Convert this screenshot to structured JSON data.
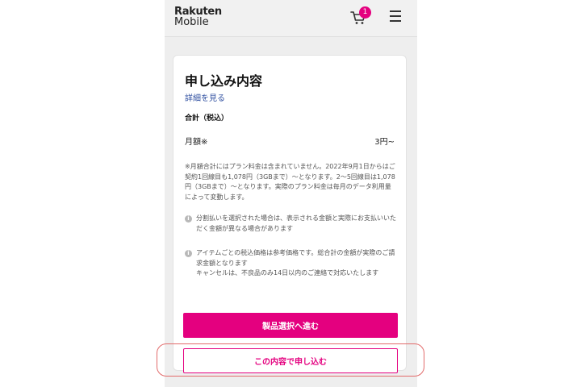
{
  "header": {
    "logo_line1": "Rakuten",
    "logo_line2": "Mobile",
    "cart_icon": "cart-icon",
    "cart_badge": "1",
    "menu_icon": "hamburger-menu-icon"
  },
  "order": {
    "title": "申し込み内容",
    "detail_link": "詳細を見る",
    "total_label": "合計（税込）",
    "monthly_label": "月額※",
    "monthly_value": "3円~",
    "note": "※月額合計にはプラン料金は含まれていません。2022年9月1日からはご契約1回線目も1,078円（3GBまで）〜となります。2〜5回線目は1,078円（3GBまで）〜となります。実際のプラン料金は毎月のデータ利用量によって変動します。",
    "info1": "分割払いを選択された場合は、表示される金額と実際にお支払いいただく金額が異なる場合があります",
    "info2_line1": "アイテムごとの税込価格は参考価格です。総合計の金額が実際のご請求金額となります",
    "info2_line2": "キャンセルは、不良品のみ14日以内のご連絡で対応いたします",
    "info_icon": "info-icon"
  },
  "buttons": {
    "proceed": "製品選択へ進む",
    "apply": "この内容で申し込む"
  },
  "colors": {
    "brand": "#e4007f",
    "highlight": "#e26b6b"
  }
}
